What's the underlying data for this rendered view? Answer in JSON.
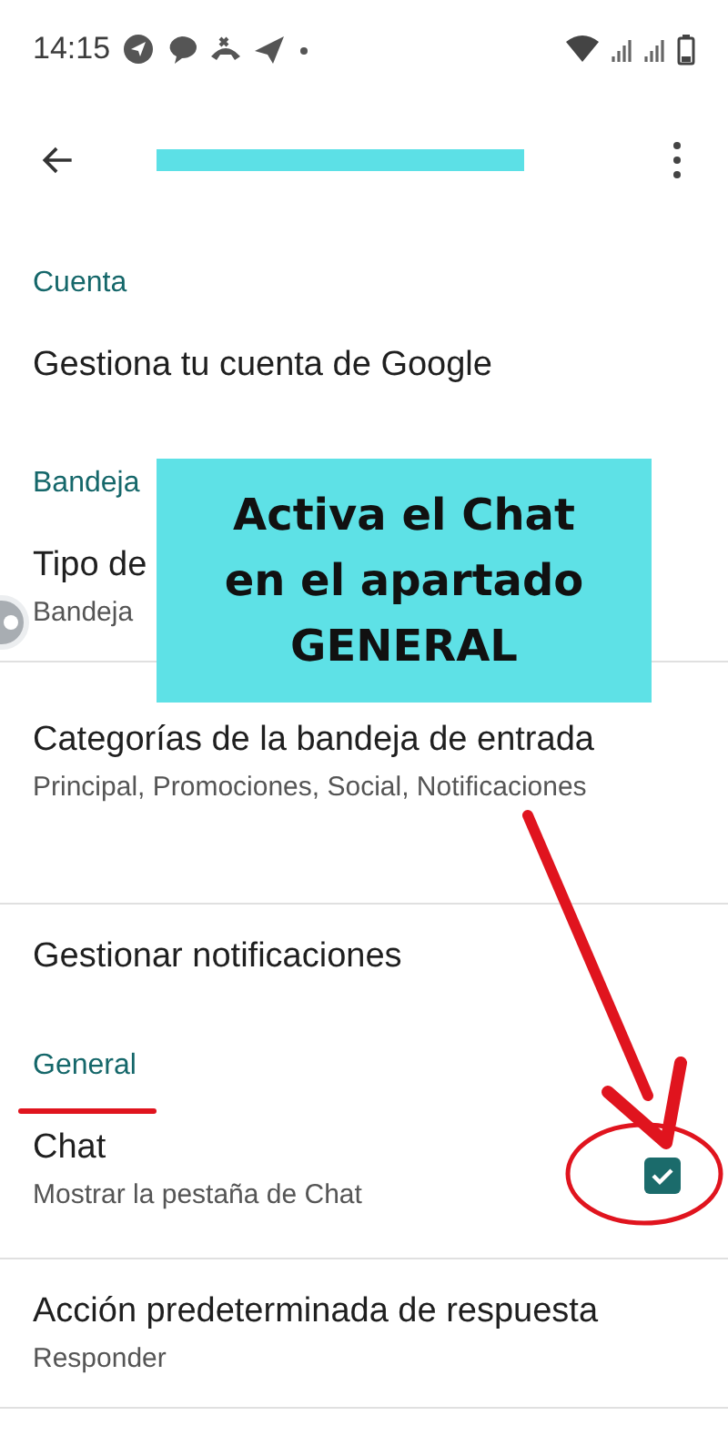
{
  "status_bar": {
    "time": "14:15"
  },
  "toolbar": {
    "account_redacted": true
  },
  "sections": [
    {
      "header": "Cuenta",
      "items": [
        {
          "kind": "text",
          "title": "Gestiona tu cuenta de Google"
        }
      ]
    },
    {
      "header": "Bandeja",
      "items": [
        {
          "kind": "text",
          "title": "Tipo de",
          "subtitle": "Bandeja"
        },
        {
          "kind": "text",
          "title": "Categorías de la bandeja de entrada",
          "subtitle": "Principal, Promociones, Social, Notificaciones"
        },
        {
          "kind": "text",
          "title": "Gestionar notificaciones"
        }
      ]
    },
    {
      "header": "General",
      "underlined": true,
      "items": [
        {
          "kind": "checkbox",
          "title": "Chat",
          "subtitle": "Mostrar la pestaña de Chat",
          "checked": true,
          "circled": true
        },
        {
          "kind": "text",
          "title": "Acción predeterminada de respuesta",
          "subtitle": "Responder"
        }
      ]
    }
  ],
  "callout": {
    "lines": [
      "Activa el Chat",
      "en el apartado",
      "GENERAL"
    ]
  }
}
